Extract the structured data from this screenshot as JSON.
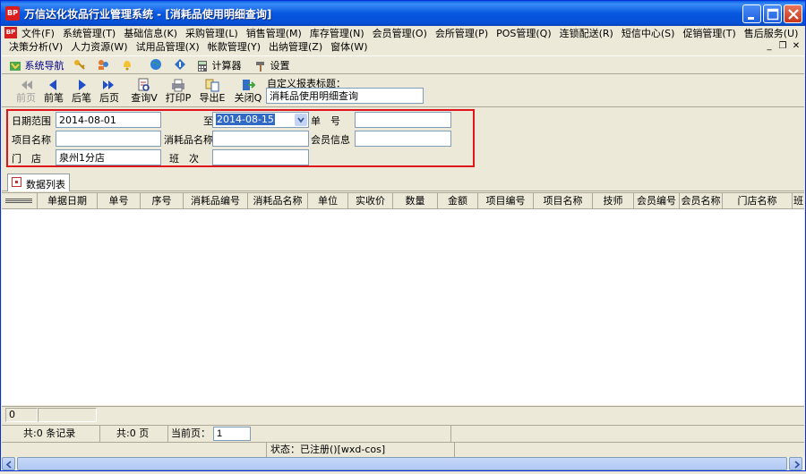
{
  "window": {
    "title": "万信达化妆品行业管理系统 - [消耗品使用明细查询]",
    "app_icon_text": "BP"
  },
  "menu": {
    "row1": [
      "文件(F)",
      "系统管理(T)",
      "基础信息(K)",
      "采购管理(L)",
      "销售管理(M)",
      "库存管理(N)",
      "会员管理(O)",
      "会所管理(P)",
      "POS管理(Q)",
      "连锁配送(R)",
      "短信中心(S)",
      "促销管理(T)",
      "售后服务(U)"
    ],
    "row2": [
      "决策分析(V)",
      "人力资源(W)",
      "试用品管理(X)",
      "帐款管理(Y)",
      "出纳管理(Z)",
      "窗体(W)"
    ]
  },
  "toolbar1": {
    "nav_label": "系统导航",
    "calculator_label": "计算器",
    "settings_label": "设置"
  },
  "toolbar2": {
    "prev_page": "前页",
    "prev_record": "前笔",
    "next_record": "后笔",
    "next_page": "后页",
    "query": "查询V",
    "print": "打印P",
    "export": "导出E",
    "close": "关闭Q",
    "report_title_label": "自定义报表标题：",
    "report_title_value": "消耗品使用明细查询"
  },
  "filter": {
    "date_range_label": "日期范围",
    "date_from": "2014-08-01",
    "to_label": "至",
    "date_to": "2014-08-15",
    "doc_no_label": "单　号",
    "doc_no_value": "",
    "project_name_label": "项目名称",
    "project_name_value": "",
    "consumable_name_label": "消耗品名称",
    "consumable_name_value": "",
    "member_info_label": "会员信息",
    "member_info_value": "",
    "store_label": "门　店",
    "store_value": "泉州1分店",
    "shift_label": "班　次",
    "shift_value": ""
  },
  "tab": {
    "label": "数据列表"
  },
  "grid": {
    "columns": [
      "单据日期",
      "单号",
      "序号",
      "消耗品编号",
      "消耗品名称",
      "单位",
      "实收价",
      "数量",
      "金额",
      "项目编号",
      "项目名称",
      "技师",
      "会员编号",
      "会员名称",
      "门店名称",
      "班"
    ]
  },
  "footer": {
    "count_value": "0"
  },
  "pager": {
    "total_records": "共:0 条记录",
    "total_pages": "共:0 页",
    "current_page_label": "当前页：",
    "current_page_value": "1"
  },
  "status": {
    "text": "状态：已注册()[wxd-cos]"
  }
}
